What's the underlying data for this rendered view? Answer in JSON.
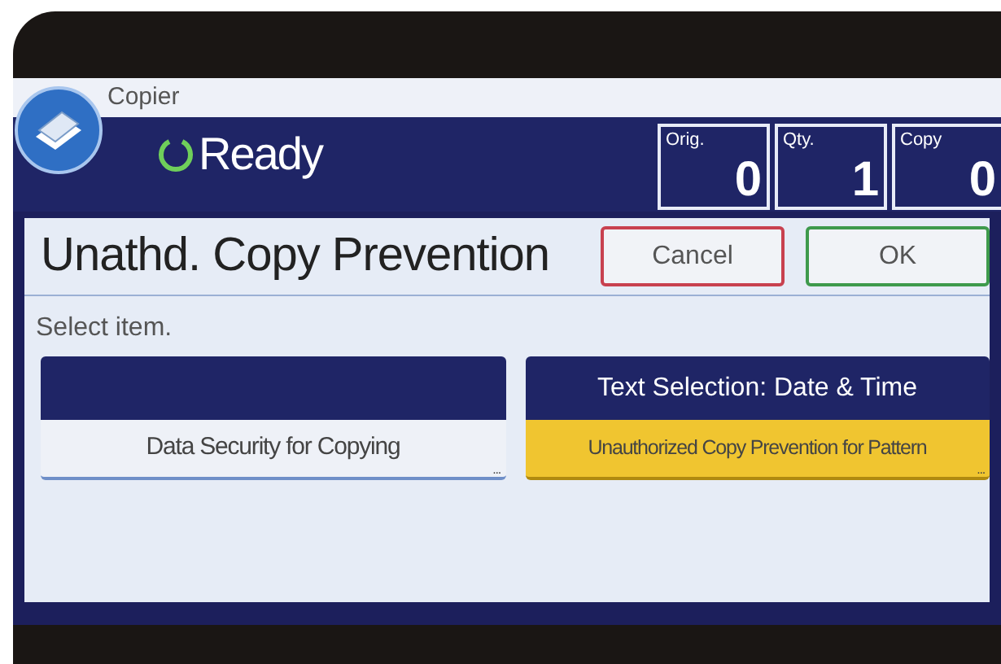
{
  "header": {
    "app": "Copier",
    "status": "Ready"
  },
  "counters": [
    {
      "label": "Orig.",
      "value": "0"
    },
    {
      "label": "Qty.",
      "value": "1"
    },
    {
      "label": "Copy",
      "value": "0"
    }
  ],
  "dialog": {
    "title": "Unathd. Copy Prevention",
    "buttons": [
      {
        "label": "Cancel",
        "kind": "cancel"
      },
      {
        "label": "OK",
        "kind": "ok"
      }
    ],
    "prompt": "Select item.",
    "options": [
      {
        "label": "Data Security for Copying",
        "more": "...",
        "selected": false
      },
      {
        "header": "Text Selection: Date & Time",
        "label": "Unauthorized Copy Prevention for Pattern",
        "more": "...",
        "selected": true
      }
    ]
  }
}
